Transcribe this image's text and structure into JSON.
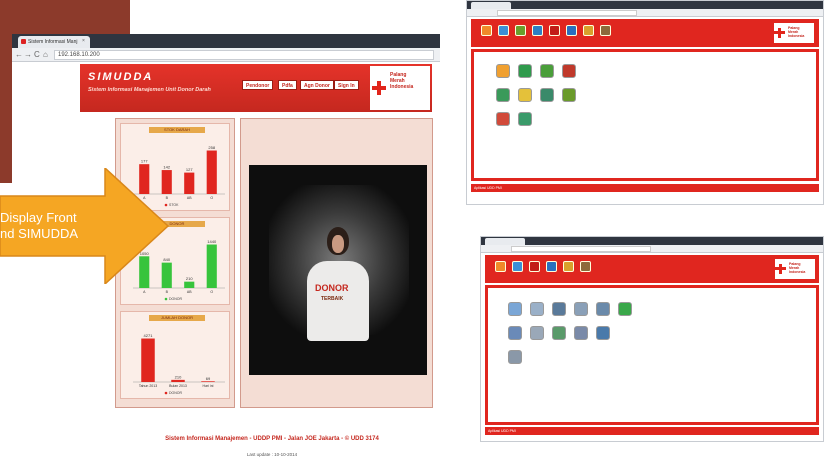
{
  "browser": {
    "tab_title": "Sistem Informasi Manj",
    "tab_close": "×",
    "back": "←",
    "forward": "→",
    "reload": "C",
    "home": "⌂",
    "url": "192.168.10.200"
  },
  "header": {
    "app_name": "SIMUDDA",
    "subtitle": "Sistem Informasi Manajemen Unit Donor Darah",
    "menu": [
      "Pendonor",
      "Pdfa",
      "Agn Donor",
      "Sign In"
    ],
    "logo_text": [
      "Palang",
      "Merah",
      "Indonesia"
    ]
  },
  "charts": [
    {
      "title": "STOK DARAH",
      "categories": [
        "A",
        "B",
        "AB",
        "O"
      ],
      "values": [
        177,
        142,
        127,
        258
      ],
      "legend": "STOK"
    },
    {
      "title": "DONOR",
      "categories": [
        "A",
        "B",
        "AB",
        "O"
      ],
      "values": [
        1050,
        840,
        210,
        1440
      ],
      "legend": "DONOR"
    },
    {
      "title": "JUMLAH DONOR",
      "categories": [
        "Tahun 2013",
        "Bulan 2013",
        "Hari ini"
      ],
      "values": [
        4271,
        210,
        69
      ],
      "legend": "DONOR"
    }
  ],
  "video": {
    "shirt_text": "DONOR",
    "shirt_sub": "TERBAIK"
  },
  "footer": {
    "line1": "Sistem Informasi Manajemen - UDDP PMI - Jalan JOE Jakarta - © UDD 3174",
    "line2": "Last update : 10-10-2014"
  },
  "callout": {
    "line1": "Display Front",
    "line2": "nd SIMUDDA"
  },
  "win1": {
    "footer": "Aplikasi UDD PMI"
  },
  "win2": {
    "footer": "Aplikasi UDD PMI"
  },
  "colors": {
    "accent": "#e0261f",
    "arrow": "#f5a623",
    "decor": "#8c3a2b"
  }
}
